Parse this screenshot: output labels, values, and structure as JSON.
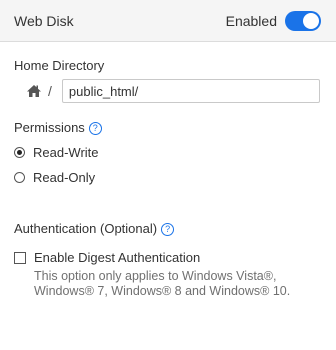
{
  "header": {
    "title": "Web Disk",
    "status_label": "Enabled",
    "toggle_on": true,
    "accent_color": "#1a73e8"
  },
  "home_directory": {
    "label": "Home Directory",
    "icon": "home-icon",
    "separator": "/",
    "value": "public_html/"
  },
  "permissions": {
    "label": "Permissions",
    "help_icon": "help-icon",
    "options": [
      {
        "label": "Read-Write",
        "checked": true
      },
      {
        "label": "Read-Only",
        "checked": false
      }
    ]
  },
  "authentication": {
    "label": "Authentication (Optional)",
    "help_icon": "help-icon",
    "digest": {
      "label": "Enable Digest Authentication",
      "checked": false,
      "description": "This option only applies to Windows Vista®, Windows® 7, Windows® 8 and Windows® 10."
    }
  }
}
